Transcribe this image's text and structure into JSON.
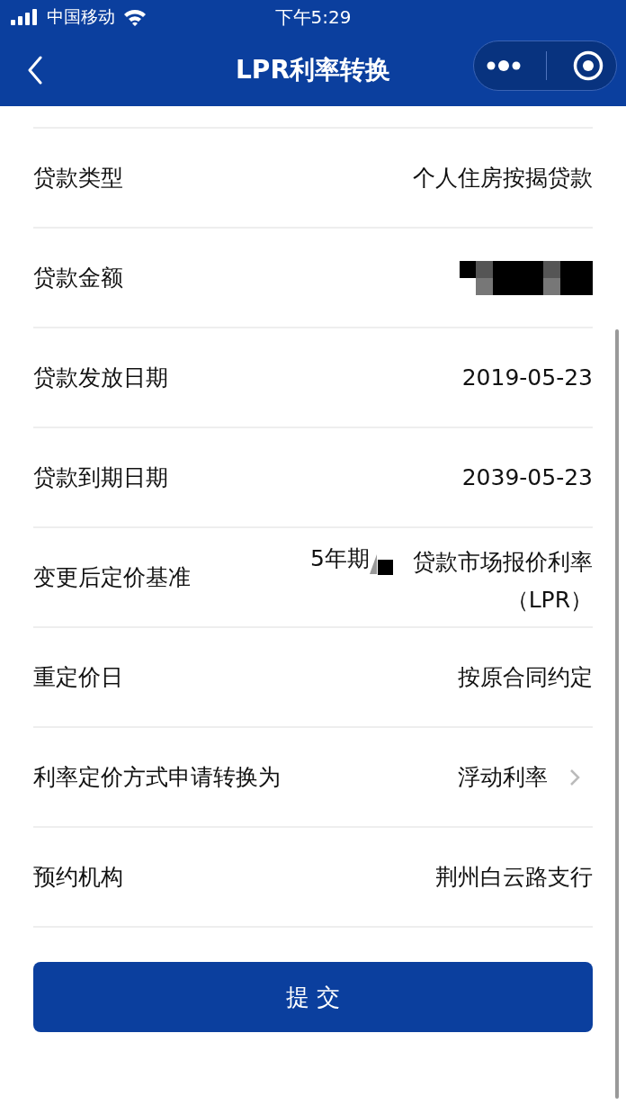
{
  "status_bar": {
    "carrier": "中国移动",
    "time": "下午5:29"
  },
  "nav": {
    "title": "LPR利率转换"
  },
  "rows": [
    {
      "kind": "text",
      "label": "贷款类型",
      "value": "个人住房按揭贷款"
    },
    {
      "kind": "redacted",
      "label": "贷款金额"
    },
    {
      "kind": "text",
      "label": "贷款发放日期",
      "value": "2019-05-23"
    },
    {
      "kind": "text",
      "label": "贷款到期日期",
      "value": "2039-05-23"
    },
    {
      "kind": "split",
      "label": "变更后定价基准",
      "prefix": "5年期",
      "value": "贷款市场报价利率（LPR）"
    },
    {
      "kind": "text",
      "label": "重定价日",
      "value": "按原合同约定"
    },
    {
      "kind": "select",
      "label": "利率定价方式申请转换为",
      "value": "浮动利率"
    },
    {
      "kind": "text",
      "label": "预约机构",
      "value": "荆州白云路支行"
    }
  ],
  "submit": "提 交"
}
